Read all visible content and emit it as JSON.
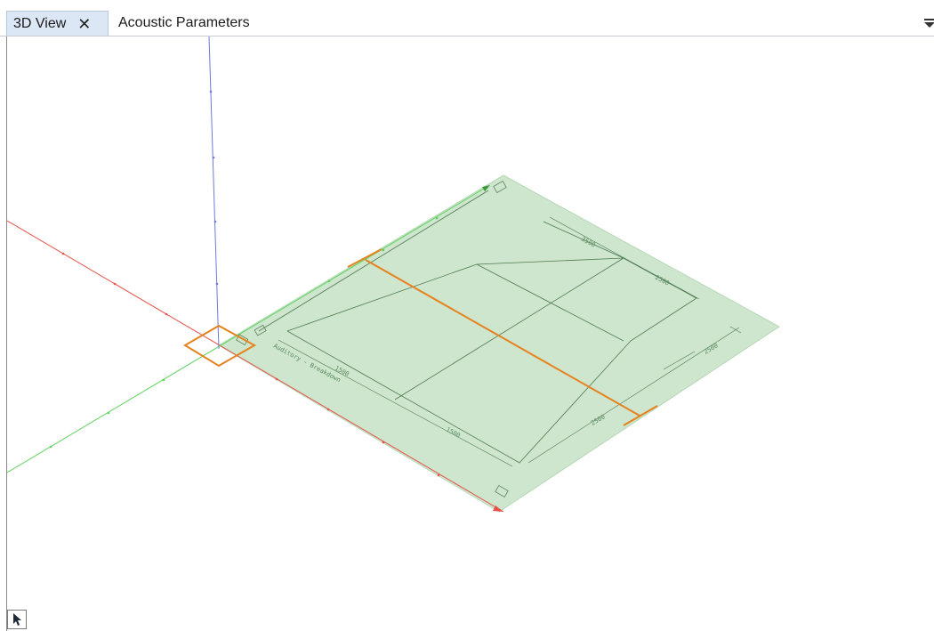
{
  "tabs": [
    {
      "label": "3D View",
      "active": true,
      "close_icon": "close-icon"
    },
    {
      "label": "Acoustic Parameters",
      "active": false
    }
  ],
  "overflow_icon": "chevron-down-icon",
  "viewport": {
    "plane_label": "Auditory - Breakdown",
    "dimensions": {
      "top_edge": "3500",
      "right_edge": "2500",
      "far_right": "2500",
      "lower_left": "1500",
      "bottom_edge": "1500",
      "front_right": "2500"
    }
  },
  "colors": {
    "plane_fill": "#cde6cd",
    "axis_x": "#e8524a",
    "axis_y": "#5fd35f",
    "axis_z": "#6f7bd8",
    "selection": "#e6821e",
    "tab_active_bg": "#dbe7f5"
  },
  "tools": {
    "select_icon": "pointer-arrow-icon"
  }
}
